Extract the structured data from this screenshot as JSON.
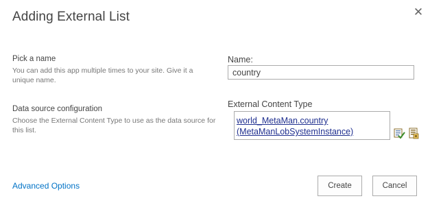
{
  "dialog": {
    "title": "Adding External List",
    "close_glyph": "✕"
  },
  "name_section": {
    "heading": "Pick a name",
    "description": "You can add this app multiple times to your site. Give it a unique name.",
    "field_label": "Name:",
    "field_value": "country"
  },
  "datasource_section": {
    "heading": "Data source configuration",
    "description": "Choose the External Content Type to use as the data source for this list.",
    "field_label": "External Content Type",
    "link_line1": "world_MetaMan.country",
    "link_line2": "(MetaManLobSystemInstance)",
    "icons": [
      "check-names-icon",
      "browse-content-types-icon"
    ]
  },
  "footer": {
    "advanced_label": "Advanced Options",
    "create_label": "Create",
    "cancel_label": "Cancel"
  },
  "colors": {
    "link": "#0072c6",
    "ect_link": "#1f2f8f",
    "border": "#ababab",
    "text": "#444444",
    "muted": "#777777"
  }
}
